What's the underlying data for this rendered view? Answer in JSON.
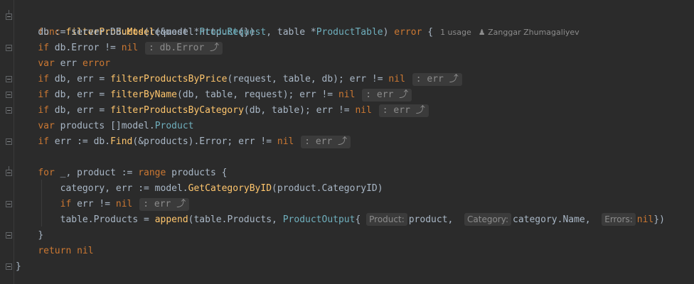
{
  "code": {
    "sig": {
      "kw": "func",
      "name": "filterProducts",
      "p1": "(request *http.",
      "t1": "Request",
      "p2": ", table *",
      "t2": "ProductTable",
      "p3": ") ",
      "ret": "error",
      "brace": " {",
      "usages": "1 usage",
      "author": "Zanggar Zhumagaliyev"
    },
    "l1": {
      "a": "db := server.DB.",
      "f": "Model",
      "b": "(&model.",
      "t": "Product",
      "c": "{})"
    },
    "l2": {
      "kw": "if",
      "a": " db.Error != ",
      "nil": "nil",
      "hint": ": db.Error"
    },
    "l3": {
      "kw": "var",
      "a": " err ",
      "ty": "error"
    },
    "l4": {
      "kw": "if",
      "a": " db, err = ",
      "f": "filterProductsByPrice",
      "b": "(request, table, db); err != ",
      "nil": "nil",
      "hint": ": err"
    },
    "l5": {
      "kw": "if",
      "a": " db, err = ",
      "f": "filterByName",
      "b": "(db, table, request); err != ",
      "nil": "nil",
      "hint": ": err"
    },
    "l6": {
      "kw": "if",
      "a": " db, err = ",
      "f": "filterProductsByCategory",
      "b": "(db, table); err != ",
      "nil": "nil",
      "hint": ": err"
    },
    "l7": {
      "kw": "var",
      "a": " products []model.",
      "t": "Product"
    },
    "l8": {
      "kw": "if",
      "a": " err := db.",
      "f": "Find",
      "b": "(&products).Error; err != ",
      "nil": "nil",
      "hint": ": err"
    },
    "l10": {
      "kw": "for",
      "a": " _, product := ",
      "kw2": "range",
      "b": " products {"
    },
    "l11": {
      "a": "category, err := model.",
      "f": "GetCategoryByID",
      "b": "(product.CategoryID)"
    },
    "l12": {
      "kw": "if",
      "a": " err != ",
      "nil": "nil",
      "hint": ": err"
    },
    "l13": {
      "a": "table.Products = ",
      "f": "append",
      "b": "(table.Products, ",
      "t": "ProductOutput",
      "c": "{",
      "h1": "Product:",
      "v1": "product, ",
      "h2": "Category:",
      "v2": "category.Name, ",
      "h3": "Errors:",
      "nil": "nil",
      "d": "})"
    },
    "l14": {
      "a": "}"
    },
    "l15": {
      "kw": "return",
      "a": " ",
      "nil": "nil"
    },
    "l16": {
      "a": "}"
    }
  },
  "icons": {
    "return_hint": "return-arrow-icon",
    "author": "person-icon"
  },
  "colors": {
    "keyword": "#cc7832",
    "function": "#ffc66d",
    "type": "#6fafbd",
    "text": "#a9b7c6",
    "background": "#2b2b2b"
  }
}
